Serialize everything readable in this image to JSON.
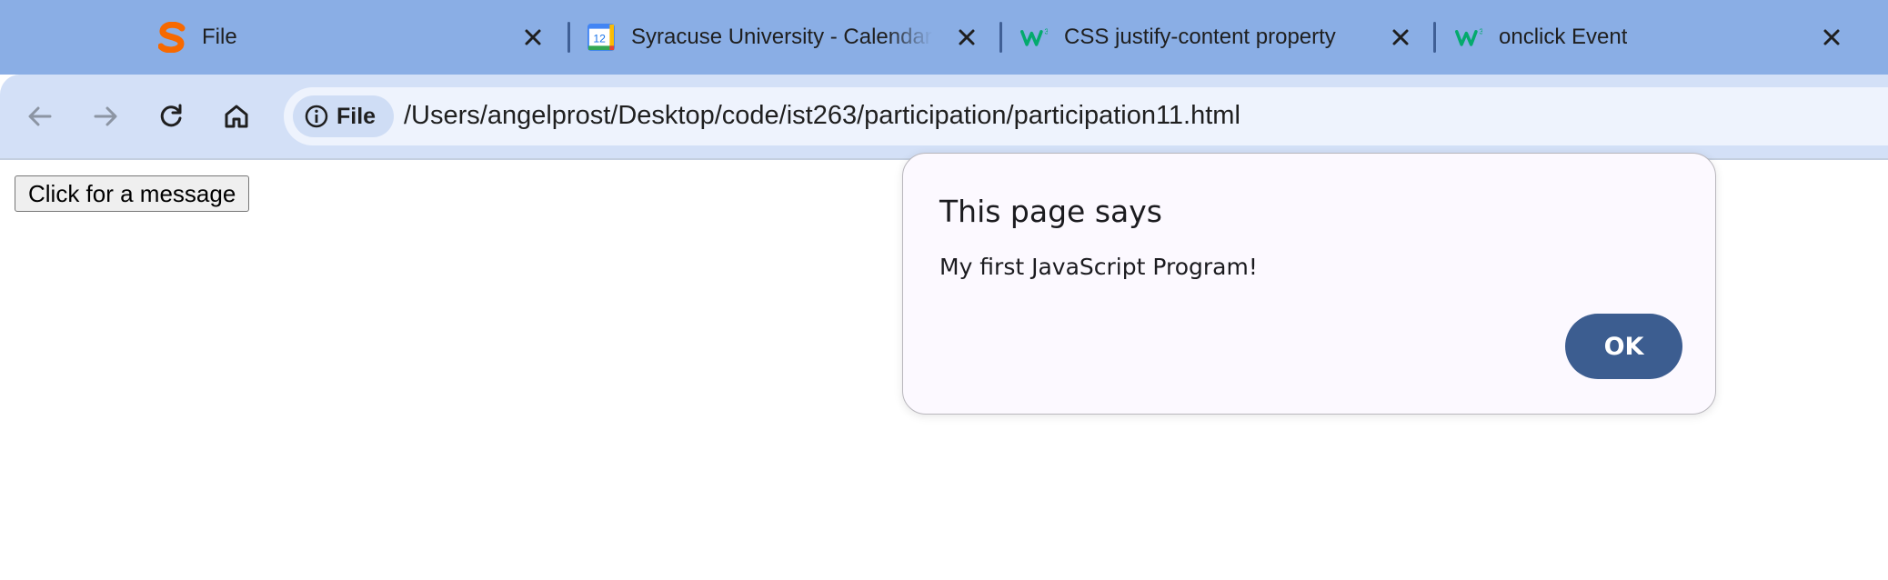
{
  "tabs": [
    {
      "title": "File",
      "icon": "syracuse-s-icon"
    },
    {
      "title": "Syracuse University - Calendar",
      "icon": "google-calendar-icon",
      "icon_text": "12"
    },
    {
      "title": "CSS justify-content property",
      "icon": "w3schools-icon"
    },
    {
      "title": "onclick Event",
      "icon": "w3schools-icon"
    }
  ],
  "toolbar": {
    "back": "back-arrow-icon",
    "forward": "forward-arrow-icon",
    "reload": "reload-icon",
    "home": "home-icon",
    "site_chip_label": "File",
    "url": "/Users/angelprost/Desktop/code/ist263/participation/participation11.html"
  },
  "page": {
    "button_label": "Click for a message"
  },
  "dialog": {
    "title": "This page says",
    "message": "My first JavaScript Program!",
    "ok_label": "OK"
  },
  "colors": {
    "tabstrip": "#8aaee5",
    "toolbar": "#d3e0f7",
    "omnibox": "#eef3fd",
    "dialog_bg": "#fcf9ff",
    "ok_button": "#3c5d90",
    "syracuse_orange": "#f76900",
    "w3_green": "#04aa6d"
  }
}
